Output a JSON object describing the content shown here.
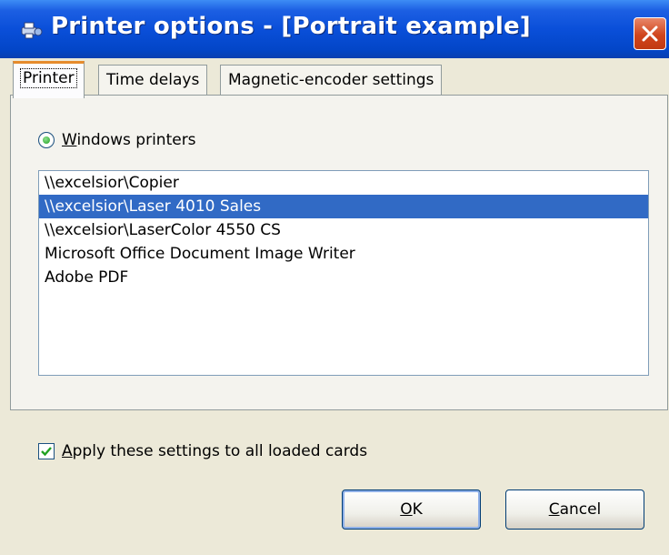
{
  "window": {
    "title": "Printer options - [Portrait example]",
    "icon": "printer-app-icon",
    "close_icon": "close-icon"
  },
  "tabs": [
    {
      "label": "Printer",
      "active": true
    },
    {
      "label": "Time delays",
      "active": false
    },
    {
      "label": "Magnetic-encoder settings",
      "active": false
    }
  ],
  "printer_panel": {
    "radio": {
      "mnemonic": "W",
      "rest": "indows printers",
      "checked": true
    },
    "printers": [
      {
        "name": "\\\\excelsior\\Copier",
        "selected": false
      },
      {
        "name": "\\\\excelsior\\Laser 4010 Sales",
        "selected": true
      },
      {
        "name": "\\\\excelsior\\LaserColor 4550 CS",
        "selected": false
      },
      {
        "name": "Microsoft Office Document Image Writer",
        "selected": false
      },
      {
        "name": "Adobe PDF",
        "selected": false
      }
    ]
  },
  "apply_checkbox": {
    "mnemonic": "A",
    "rest": "pply these settings to all loaded cards",
    "checked": true
  },
  "buttons": {
    "ok": {
      "mnemonic": "O",
      "rest": "K"
    },
    "cancel": {
      "mnemonic": "C",
      "rest": "ancel"
    }
  },
  "colors": {
    "titlebar": "#0a4fd9",
    "selection": "#316ac5",
    "tab_highlight": "#e68b2c",
    "close_button": "#d0451d",
    "checkmark": "#21a121"
  }
}
